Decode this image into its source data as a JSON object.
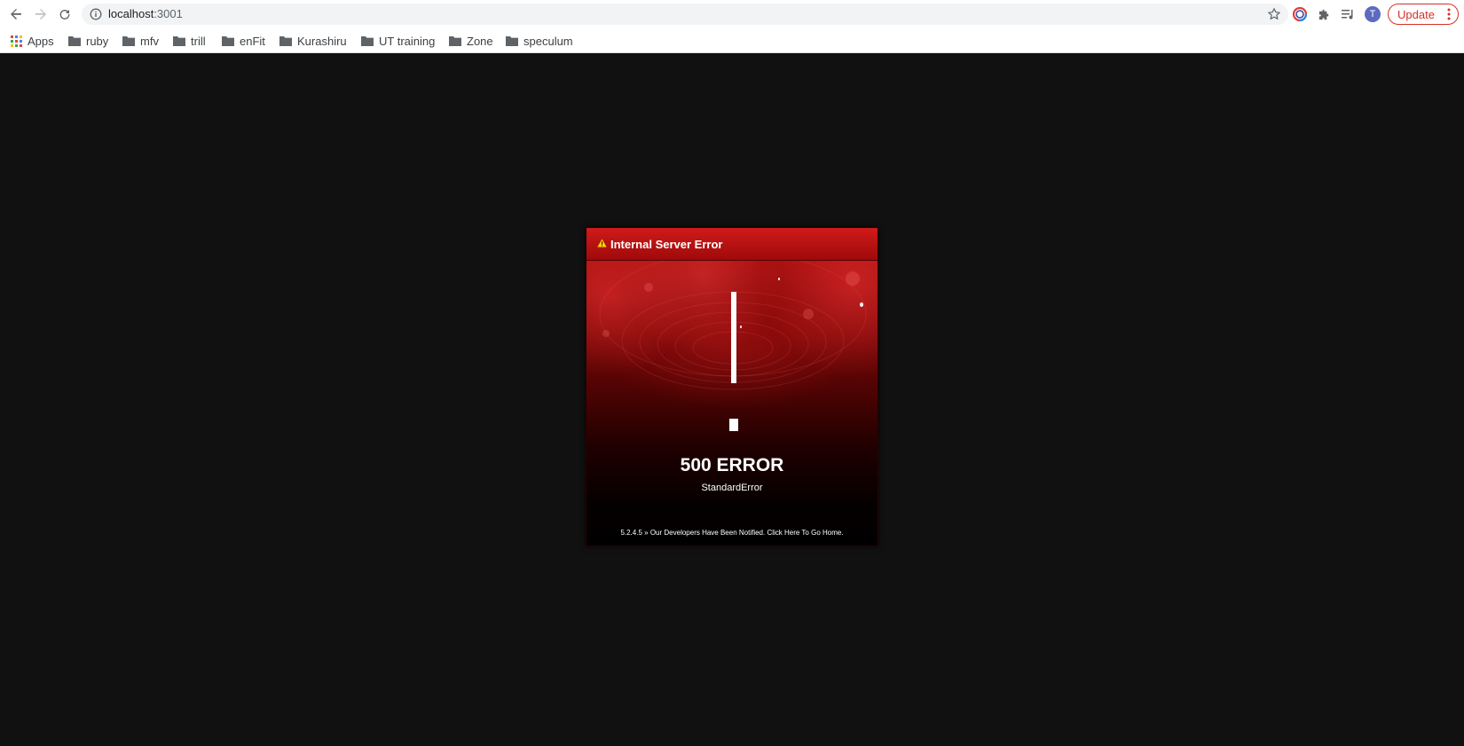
{
  "browser": {
    "url_host": "localhost",
    "url_port": ":3001",
    "update_label": "Update",
    "avatar_initial": "T",
    "colors": {
      "update_red": "#d93025",
      "avatar": "#5c6bc0"
    }
  },
  "bookmarks": {
    "apps_label": "Apps",
    "folders": [
      "ruby",
      "mfv",
      "trill",
      "enFit",
      "Kurashiru",
      "UT training",
      "Zone",
      "speculum"
    ]
  },
  "error_page": {
    "header_title": "Internal Server Error",
    "code": "500 ERROR",
    "exception": "StandardError",
    "version": "5.2.4.5",
    "separator": "»",
    "footer_text": "Our Developers Have Been Notified. Click Here To Go Home.",
    "colors": {
      "header_red": "#c81414",
      "background": "#111111"
    }
  }
}
